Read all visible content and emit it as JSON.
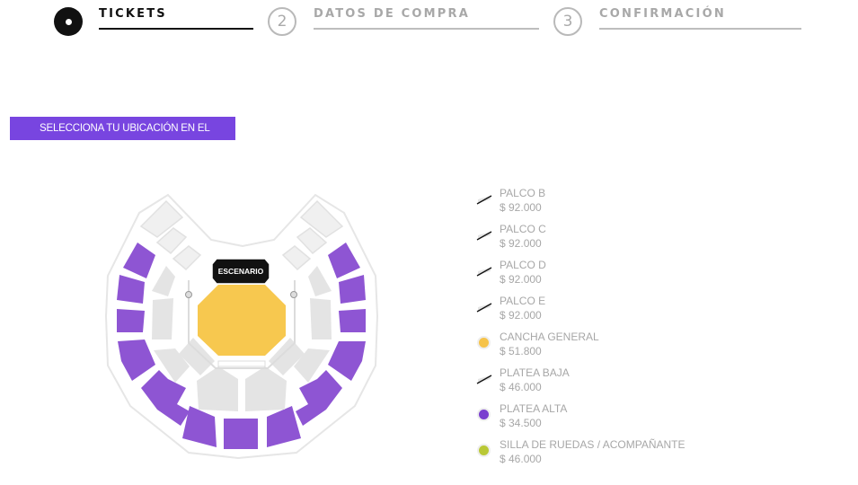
{
  "steps": [
    {
      "number": "",
      "label": "TICKETS",
      "state": "active"
    },
    {
      "number": "2",
      "label": "DATOS DE COMPRA",
      "state": "inactive"
    },
    {
      "number": "3",
      "label": "CONFIRMACIÓN",
      "state": "inactive"
    }
  ],
  "banner": {
    "text": "SELECCIONA TU UBICACIÓN EN EL MAPA"
  },
  "map": {
    "stage_label": "ESCENARIO"
  },
  "legend": [
    {
      "name": "PALCO B",
      "price": "$ 92.000",
      "status": "sold-out"
    },
    {
      "name": "PALCO C",
      "price": "$ 92.000",
      "status": "sold-out"
    },
    {
      "name": "PALCO D",
      "price": "$ 92.000",
      "status": "sold-out"
    },
    {
      "name": "PALCO E",
      "price": "$ 92.000",
      "status": "sold-out"
    },
    {
      "name": "CANCHA GENERAL",
      "price": "$ 51.800",
      "status": "available",
      "color": "#f6c34a"
    },
    {
      "name": "PLATEA BAJA",
      "price": "$ 46.000",
      "status": "sold-out"
    },
    {
      "name": "PLATEA ALTA",
      "price": "$ 34.500",
      "status": "available",
      "color": "#7a3fcf"
    },
    {
      "name": "SILLA DE RUEDAS / ACOMPAÑANTE",
      "price": "$ 46.000",
      "status": "available",
      "color": "#b9c836"
    }
  ],
  "colors": {
    "accent": "#7845e0",
    "platea_alta": "#8e55d3",
    "cancha": "#f7c84f",
    "silla": "#b9c836"
  }
}
